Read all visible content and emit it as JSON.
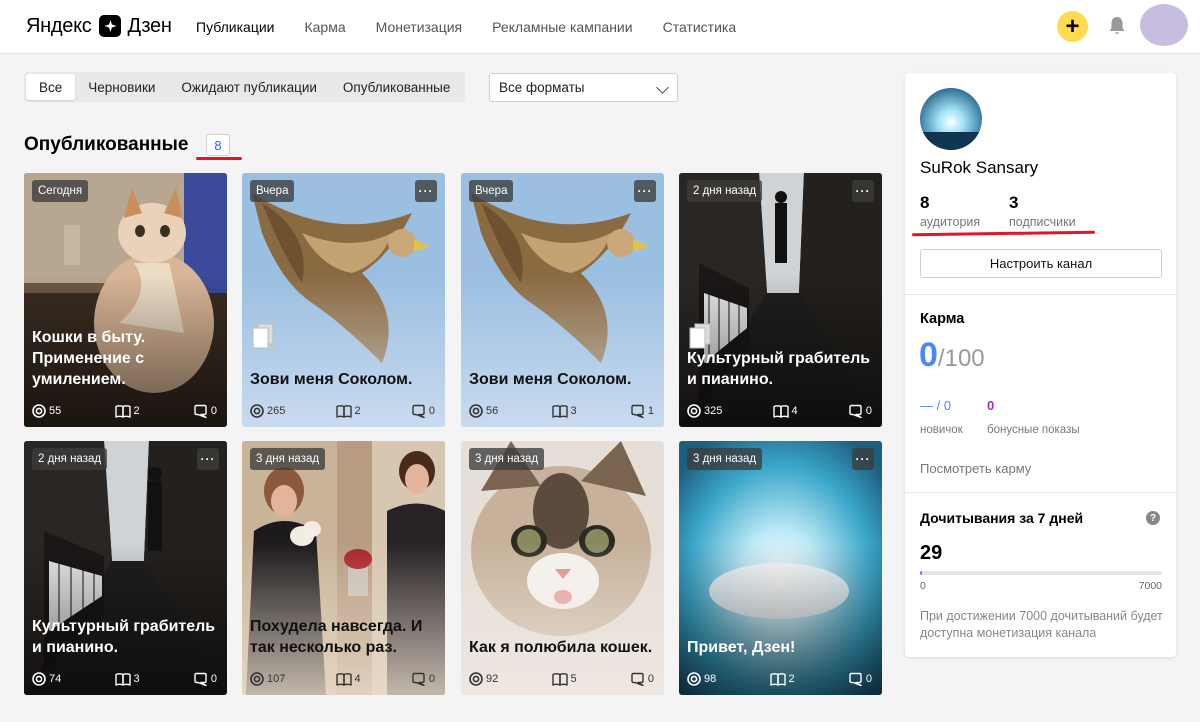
{
  "header": {
    "logo_left": "Яндекс",
    "logo_right": "Дзен",
    "nav": [
      {
        "label": "Публикации"
      },
      {
        "label": "Карма"
      },
      {
        "label": "Монетизация"
      },
      {
        "label": "Рекламные кампании"
      },
      {
        "label": "Статистика"
      }
    ],
    "add_label": "+"
  },
  "filters": {
    "tabs": [
      {
        "label": "Все"
      },
      {
        "label": "Черновики"
      },
      {
        "label": "Ожидают публикации"
      },
      {
        "label": "Опубликованные"
      }
    ],
    "format_select": "Все форматы"
  },
  "section": {
    "title": "Опубликованные",
    "count": "8"
  },
  "cards": [
    {
      "date": "Сегодня",
      "more": "···",
      "title": "Кошки в быту. Применение с умилением.",
      "views": "55",
      "reads": "2",
      "comments": "0"
    },
    {
      "date": "Вчера",
      "more": "···",
      "title": "Зови меня Соколом.",
      "views": "265",
      "reads": "2",
      "comments": "0"
    },
    {
      "date": "Вчера",
      "more": "···",
      "title": "Зови меня Соколом.",
      "views": "56",
      "reads": "3",
      "comments": "1"
    },
    {
      "date": "2 дня назад",
      "more": "···",
      "title": "Культурный грабитель и пианино.",
      "views": "325",
      "reads": "4",
      "comments": "0"
    },
    {
      "date": "2 дня назад",
      "more": "···",
      "title": "Культурный грабитель и пианино.",
      "views": "74",
      "reads": "3",
      "comments": "0"
    },
    {
      "date": "3 дня назад",
      "more": "···",
      "title": "Похудела навсегда. И так несколько раз.",
      "views": "107",
      "reads": "4",
      "comments": "0"
    },
    {
      "date": "3 дня назад",
      "more": "···",
      "title": "Как я полюбила кошек.",
      "views": "92",
      "reads": "5",
      "comments": "0"
    },
    {
      "date": "3 дня назад",
      "more": "···",
      "title": "Привет, Дзен!",
      "views": "98",
      "reads": "2",
      "comments": "0"
    }
  ],
  "sidebar": {
    "channel_name": "SuRok Sansary",
    "audience_value": "8",
    "audience_label": "аудитория",
    "subscribers_value": "3",
    "subscribers_label": "подписчики",
    "configure_button": "Настроить канал",
    "karma_title": "Карма",
    "karma_value": "0",
    "karma_max": "/100",
    "novice_value": "— / 0",
    "novice_label": "новичок",
    "bonus_value": "0",
    "bonus_label": "бонусные показы",
    "karma_link": "Посмотреть карму",
    "reads_title": "Дочитывания за 7 дней",
    "reads_help": "?",
    "reads_value": "29",
    "reads_min": "0",
    "reads_max": "7000",
    "reads_progress": 0.004,
    "reads_note": "При достижении 7000 дочитываний будет доступна монетизация канала"
  },
  "colors": {
    "accent": "#4a8af4",
    "highlight": "#e2142a",
    "add_button": "#ffdb4d",
    "bonus": "#9b2fd6"
  }
}
